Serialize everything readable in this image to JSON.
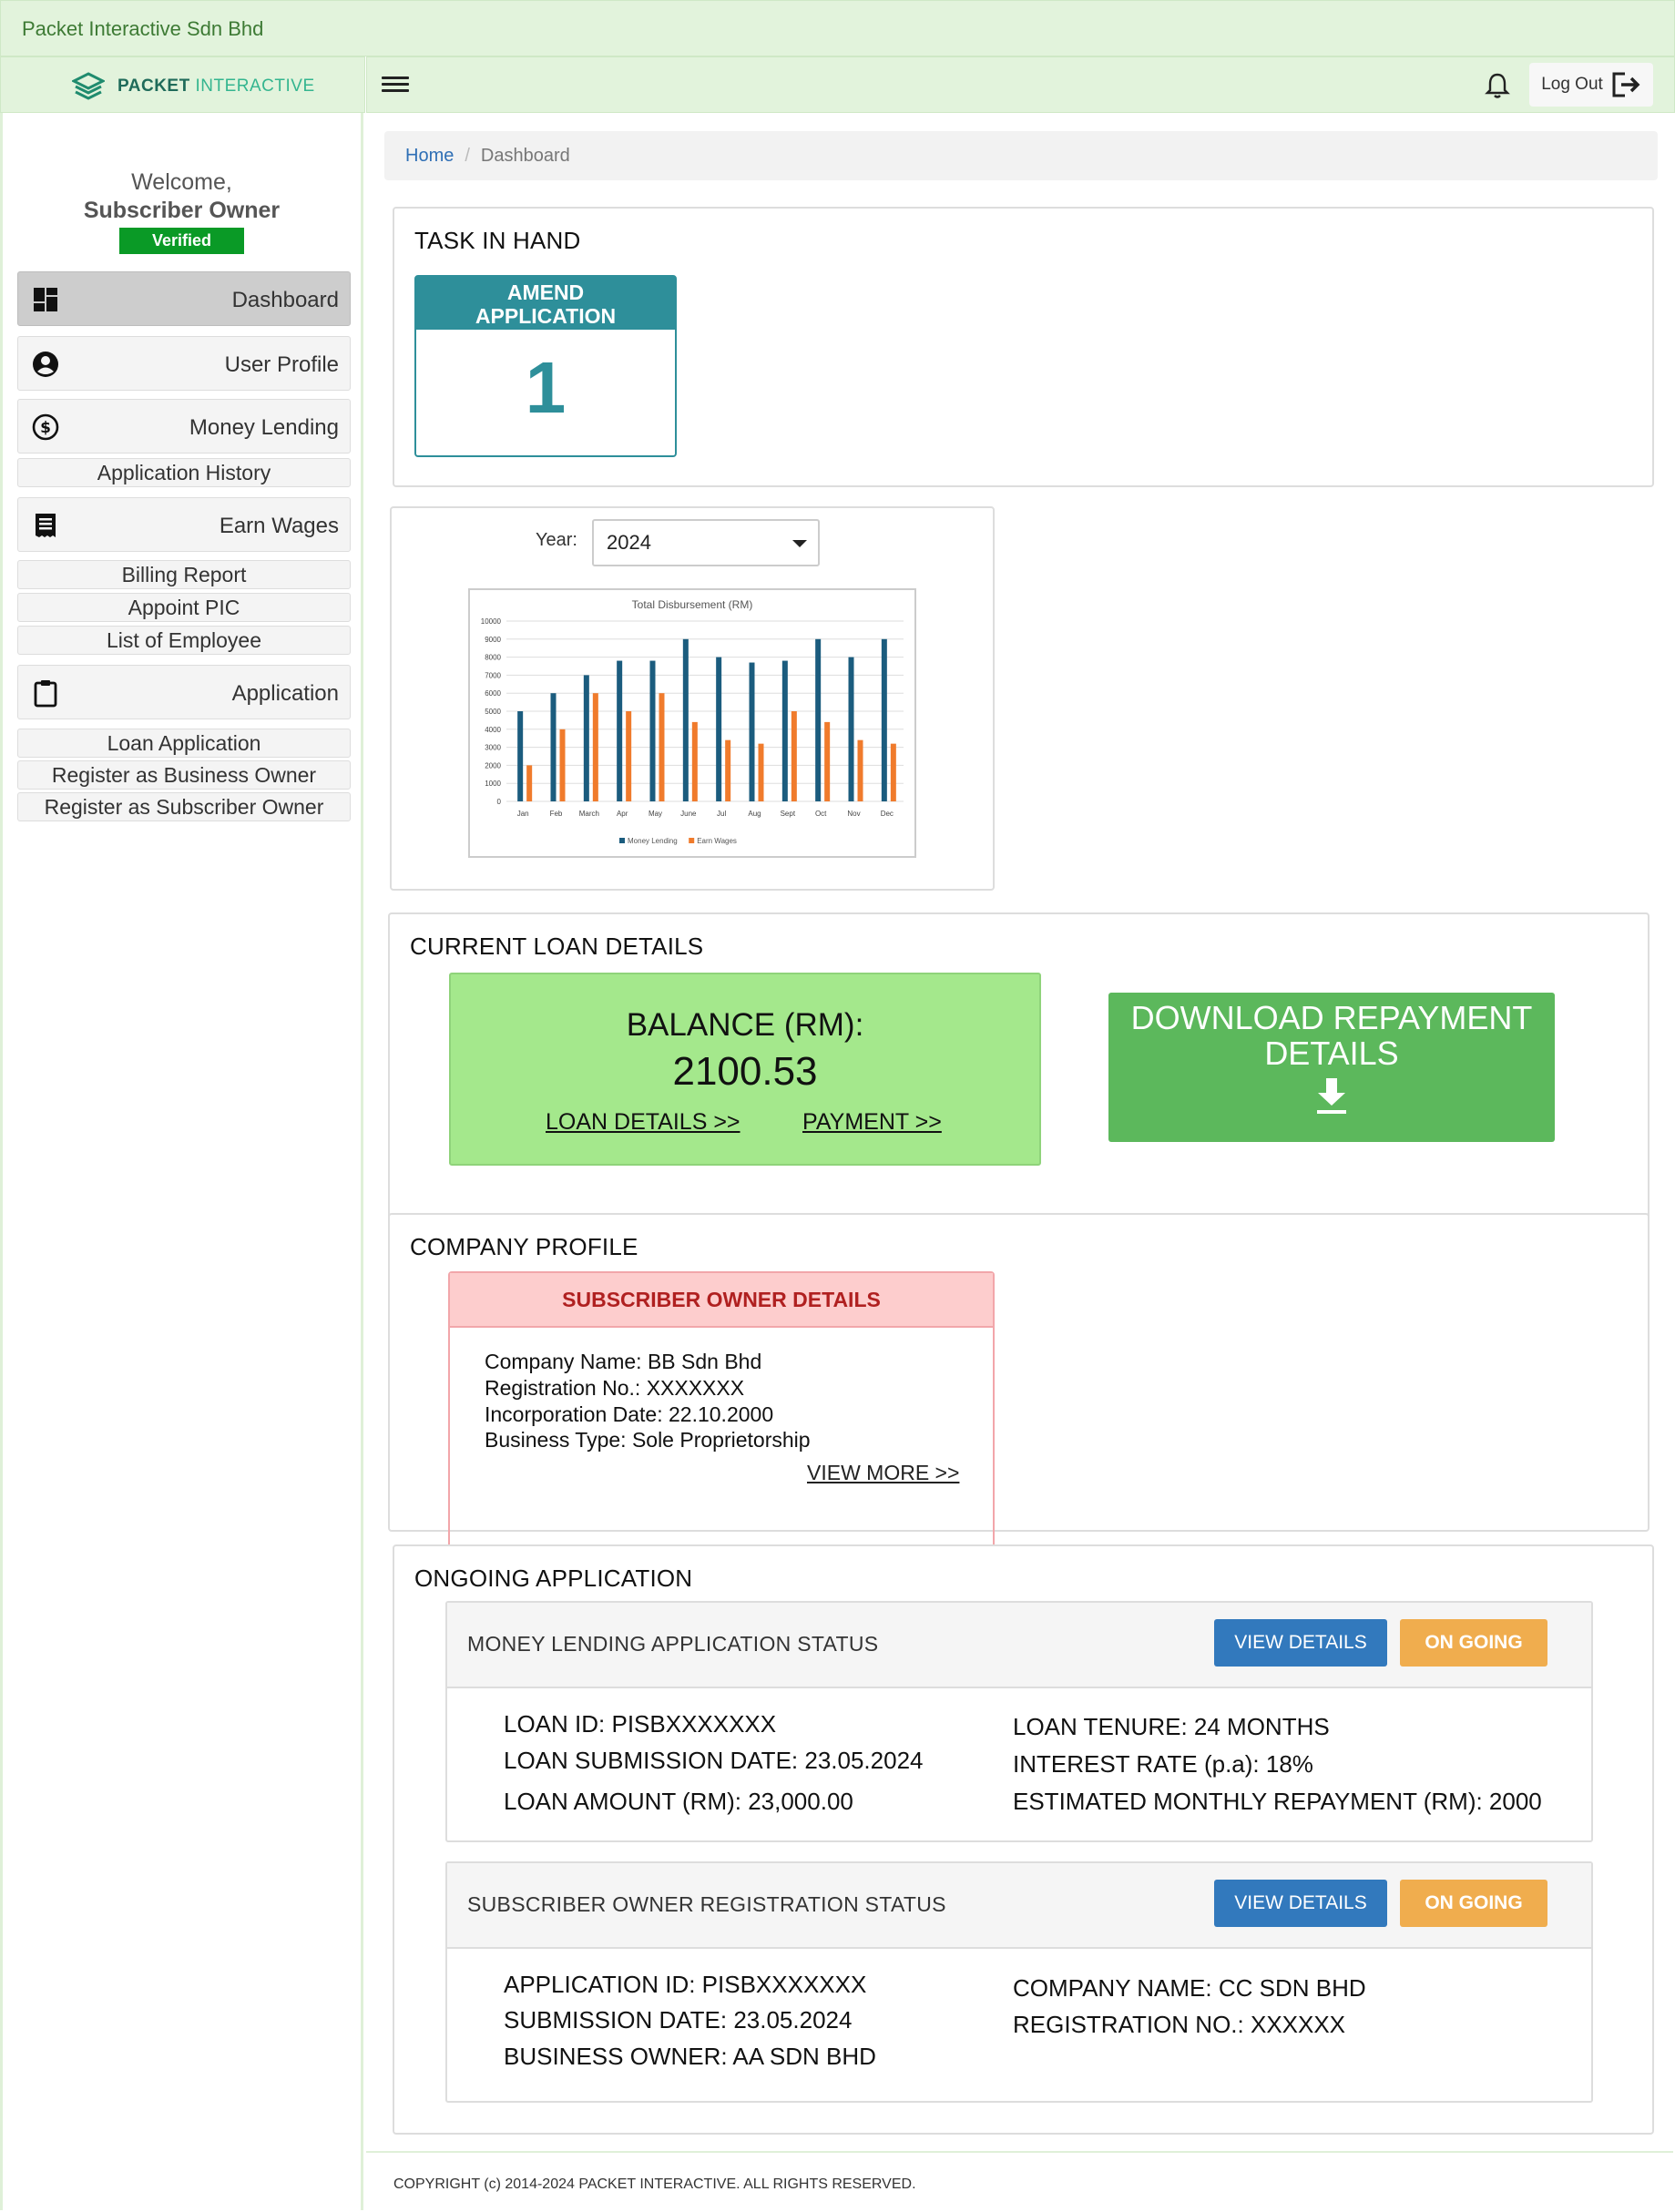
{
  "topbar": {
    "title": "Packet Interactive Sdn Bhd"
  },
  "brand": {
    "name_bold": "PACKET",
    "name_light": "INTERACTIVE"
  },
  "header": {
    "logout_label": "Log Out"
  },
  "sidebar": {
    "welcome": "Welcome,",
    "user": "Subscriber Owner",
    "verified": "Verified",
    "items": [
      {
        "label": "Dashboard",
        "icon": "dashboard-icon"
      },
      {
        "label": "User Profile",
        "icon": "user-circle-icon"
      },
      {
        "label": "Money Lending",
        "icon": "dollar-circle-icon"
      },
      {
        "label": "Application History"
      },
      {
        "label": "Earn Wages",
        "icon": "receipt-icon"
      },
      {
        "label": "Billing Report"
      },
      {
        "label": "Appoint PIC"
      },
      {
        "label": "List of Employee"
      },
      {
        "label": "Application",
        "icon": "clipboard-icon"
      },
      {
        "label": "Loan Application"
      },
      {
        "label": "Register as Business Owner"
      },
      {
        "label": "Register as Subscriber Owner"
      }
    ]
  },
  "breadcrumb": {
    "home": "Home",
    "current": "Dashboard"
  },
  "task": {
    "title": "TASK IN HAND",
    "tile_line1": "AMEND",
    "tile_line2": "APPLICATION",
    "count": "1"
  },
  "year": {
    "label": "Year:",
    "selected": "2024"
  },
  "chart_data": {
    "type": "bar",
    "title": "Total Disbursement (RM)",
    "categories": [
      "Jan",
      "Feb",
      "March",
      "Apr",
      "May",
      "June",
      "Jul",
      "Aug",
      "Sept",
      "Oct",
      "Nov",
      "Dec"
    ],
    "series": [
      {
        "name": "Money Lending",
        "color": "#1b5c7e",
        "values": [
          5000,
          6000,
          7000,
          7800,
          7800,
          9000,
          8000,
          7700,
          7800,
          9000,
          8000,
          9000
        ]
      },
      {
        "name": "Earn Wages",
        "color": "#f07b2c",
        "values": [
          2000,
          4000,
          6000,
          5000,
          6000,
          4400,
          3400,
          3200,
          5000,
          4400,
          3400,
          3200
        ]
      }
    ],
    "yticks": [
      "0",
      "1000",
      "2000",
      "3000",
      "4000",
      "5000",
      "6000",
      "7000",
      "8000",
      "9000",
      "10000"
    ],
    "ylim": [
      0,
      10000
    ],
    "grid": true,
    "legend": "bottom"
  },
  "loan": {
    "title": "CURRENT LOAN DETAILS",
    "balance_label": "BALANCE (RM):",
    "balance_value": "2100.53",
    "details_link": "LOAN DETAILS >>",
    "payment_link": "PAYMENT >>",
    "download_line1": "DOWNLOAD REPAYMENT",
    "download_line2": "DETAILS"
  },
  "profile": {
    "title": "COMPANY PROFILE",
    "box_title": "SUBSCRIBER OWNER DETAILS",
    "lines": [
      "Company Name: BB Sdn Bhd",
      "Registration No.: XXXXXXX",
      "Incorporation Date: 22.10.2000",
      "Business Type: Sole Proprietorship"
    ],
    "view_more": "VIEW MORE >>"
  },
  "ongoing": {
    "title": "ONGOING APPLICATION",
    "view_label": "VIEW DETAILS",
    "status_label": "ON GOING",
    "apps": [
      {
        "title": "MONEY LENDING APPLICATION STATUS",
        "left": [
          "LOAN ID: PISBXXXXXXX",
          "LOAN SUBMISSION DATE: 23.05.2024",
          "LOAN AMOUNT (RM): 23,000.00"
        ],
        "right": [
          "LOAN TENURE: 24 MONTHS",
          "INTEREST RATE (p.a): 18%",
          "ESTIMATED MONTHLY REPAYMENT (RM): 2000"
        ]
      },
      {
        "title": "SUBSCRIBER OWNER REGISTRATION STATUS",
        "left": [
          "APPLICATION ID: PISBXXXXXXX",
          "SUBMISSION DATE: 23.05.2024",
          "BUSINESS OWNER: AA SDN BHD"
        ],
        "right": [
          "COMPANY NAME: CC SDN BHD",
          "REGISTRATION NO.: XXXXXX"
        ]
      }
    ]
  },
  "footer": {
    "text": "COPYRIGHT (c) 2014-2024 PACKET INTERACTIVE. ALL RIGHTS RESERVED."
  }
}
